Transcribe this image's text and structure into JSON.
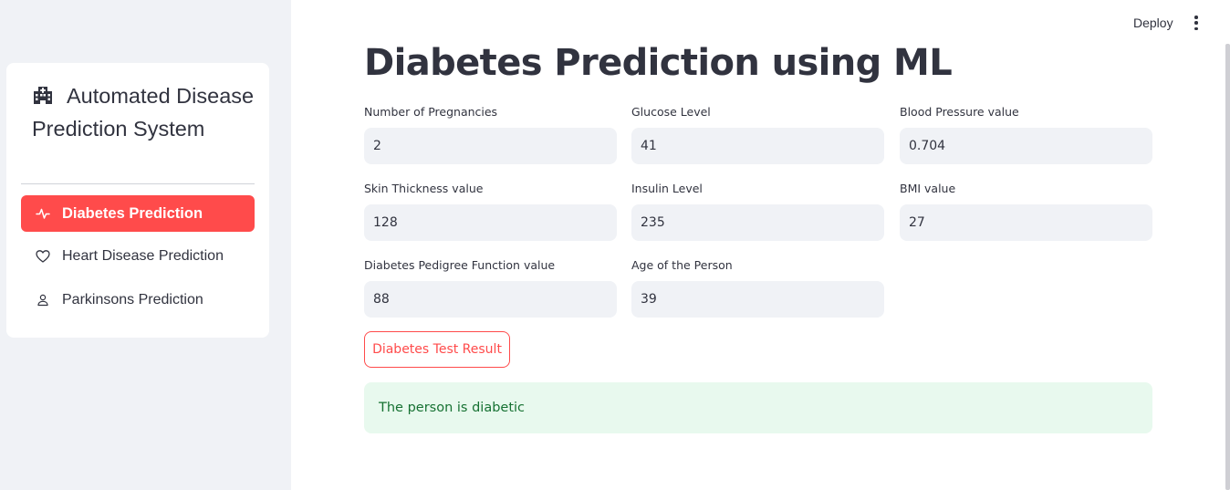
{
  "header": {
    "deploy_label": "Deploy",
    "menu_icon": "kebab-vertical-icon"
  },
  "sidebar": {
    "menu_title": "Automated Disease Prediction System",
    "menu_icon": "hospital-icon",
    "items": [
      {
        "label": "Diabetes Prediction",
        "icon": "activity-icon",
        "active": true
      },
      {
        "label": "Heart Disease Prediction",
        "icon": "heart-icon",
        "active": false
      },
      {
        "label": "Parkinsons Prediction",
        "icon": "person-icon",
        "active": false
      }
    ],
    "accent_color": "#ff4b4b"
  },
  "main": {
    "title": "Diabetes Prediction using ML",
    "fields": [
      {
        "label": "Number of Pregnancies",
        "value": "2"
      },
      {
        "label": "Glucose Level",
        "value": "41"
      },
      {
        "label": "Blood Pressure value",
        "value": "0.704"
      },
      {
        "label": "Skin Thickness value",
        "value": "128"
      },
      {
        "label": "Insulin Level",
        "value": "235"
      },
      {
        "label": "BMI value",
        "value": "27"
      },
      {
        "label": "Diabetes Pedigree Function value",
        "value": "88"
      },
      {
        "label": "Age of the Person",
        "value": "39"
      }
    ],
    "button_label": "Diabetes Test Result",
    "result_text": "The person is diabetic",
    "success_bg": "#e8f9ee",
    "success_color": "#177233"
  }
}
